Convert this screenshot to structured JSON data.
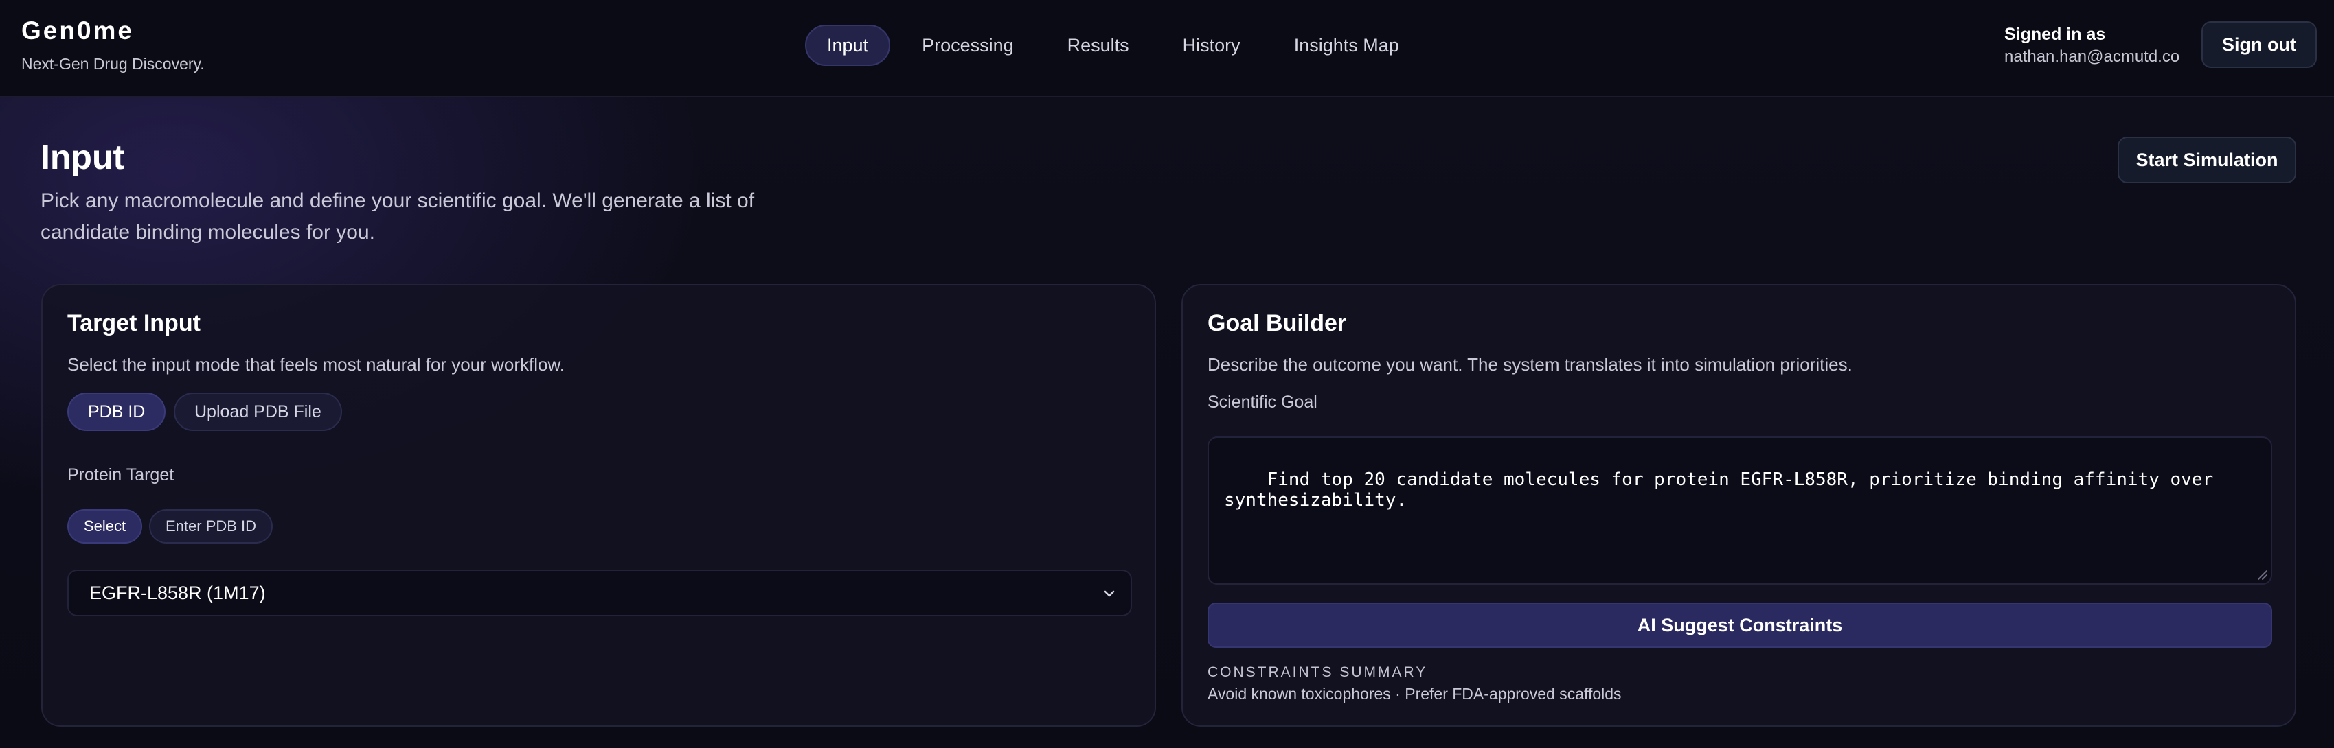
{
  "app": {
    "name": "Gen0me",
    "tagline": "Next-Gen Drug Discovery."
  },
  "nav": {
    "tabs": [
      {
        "label": "Input",
        "active": true
      },
      {
        "label": "Processing",
        "active": false
      },
      {
        "label": "Results",
        "active": false
      },
      {
        "label": "History",
        "active": false
      },
      {
        "label": "Insights Map",
        "active": false
      }
    ]
  },
  "user": {
    "signed_in_label": "Signed in as",
    "email": "nathan.han@acmutd.co",
    "sign_out_label": "Sign out"
  },
  "page": {
    "title": "Input",
    "subtitle": "Pick any macromolecule and define your scientific goal. We'll generate a list of candidate binding molecules for you.",
    "start_button": "Start Simulation"
  },
  "target_input": {
    "title": "Target Input",
    "description": "Select the input mode that feels most natural for your workflow.",
    "modes": [
      {
        "label": "PDB ID",
        "active": true
      },
      {
        "label": "Upload PDB File",
        "active": false
      }
    ],
    "protein_label": "Protein Target",
    "protein_modes": [
      {
        "label": "Select",
        "active": true
      },
      {
        "label": "Enter PDB ID",
        "active": false
      }
    ],
    "selected_protein": "EGFR-L858R (1M17)"
  },
  "goal_builder": {
    "title": "Goal Builder",
    "description": "Describe the outcome you want. The system translates it into simulation priorities.",
    "goal_label": "Scientific Goal",
    "goal_value": "Find top 20 candidate molecules for protein EGFR-L858R, prioritize binding affinity over synthesizability.",
    "suggest_button": "AI Suggest Constraints",
    "summary_label": "CONSTRAINTS SUMMARY",
    "summary_text": "Avoid known toxicophores · Prefer FDA-approved scaffolds"
  },
  "colors": {
    "accent": "#2c2c62",
    "background": "#0e0e1c",
    "card": "#121222"
  }
}
